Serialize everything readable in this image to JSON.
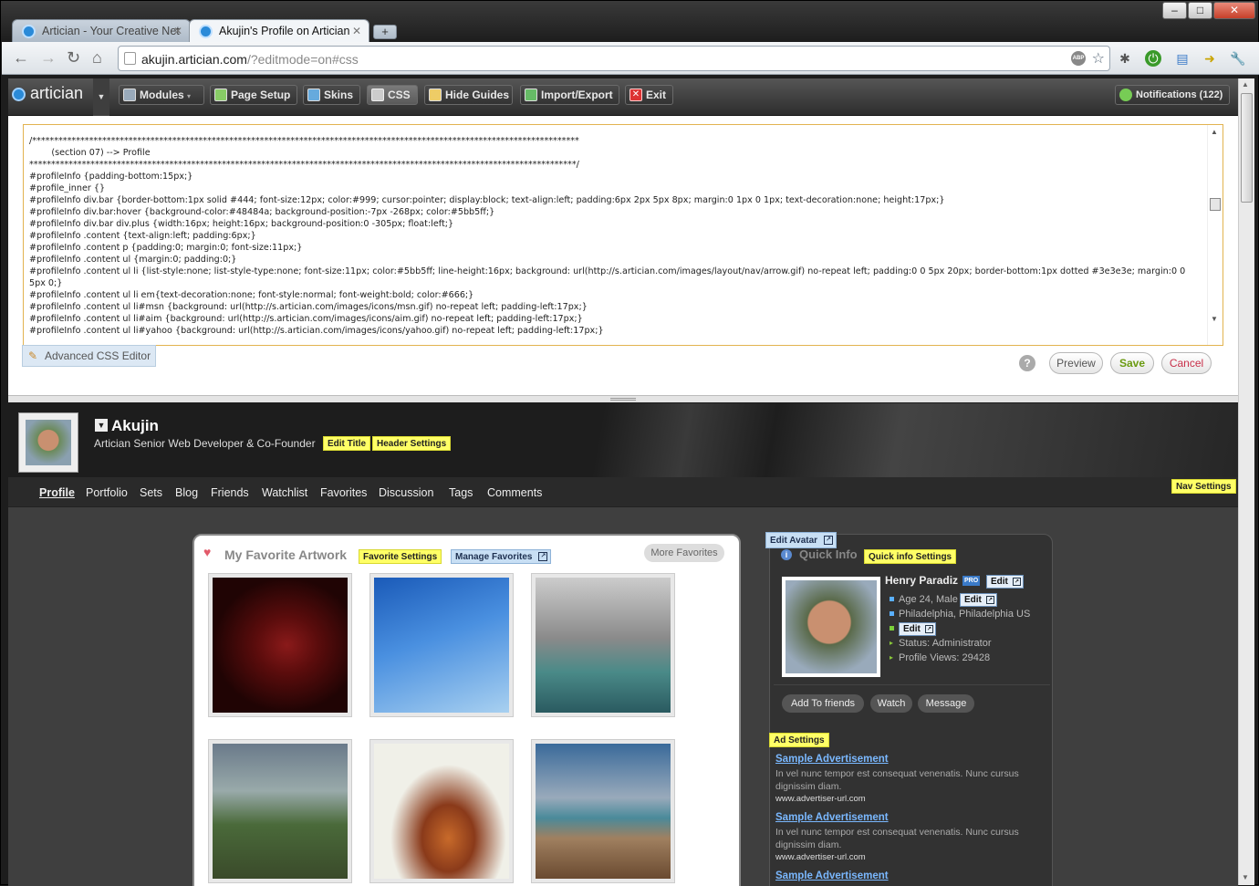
{
  "browser": {
    "tabs": [
      {
        "title": "Artician - Your Creative Net"
      },
      {
        "title": "Akujin's Profile on Artician"
      }
    ],
    "url_host": "akujin.artician.com",
    "url_path": "/?editmode=on#css",
    "window_buttons": {
      "minimize": "–",
      "maximize": "□",
      "close": "✕"
    }
  },
  "editbar": {
    "logo": "artician",
    "buttons": [
      {
        "label": "Modules"
      },
      {
        "label": "Page Setup"
      },
      {
        "label": "Skins"
      },
      {
        "label": "CSS"
      },
      {
        "label": "Hide Guides"
      },
      {
        "label": "Import/Export"
      },
      {
        "label": "Exit"
      }
    ],
    "notifications": "Notifications (122)"
  },
  "css_editor": {
    "code": "/*****************************************************************************************************************************\n        (section 07) --> Profile\n*****************************************************************************************************************************/\n#profileInfo {padding-bottom:15px;}\n#profile_inner {}\n#profileInfo div.bar {border-bottom:1px solid #444; font-size:12px; color:#999; cursor:pointer; display:block; text-align:left; padding:6px 2px 5px 8px; margin:0 1px 0 1px; text-decoration:none; height:17px;}\n#profileInfo div.bar:hover {background-color:#48484a; background-position:-7px -268px; color:#5bb5ff;}\n#profileInfo div.bar div.plus {width:16px; height:16px; background-position:0 -305px; float:left;}\n#profileInfo .content {text-align:left; padding:6px;}\n#profileInfo .content p {padding:0; margin:0; font-size:11px;}\n#profileInfo .content ul {margin:0; padding:0;}\n#profileInfo .content ul li {list-style:none; list-style-type:none; font-size:11px; color:#5bb5ff; line-height:16px; background: url(http://s.artician.com/images/layout/nav/arrow.gif) no-repeat left; padding:0 0 5px 20px; border-bottom:1px dotted #3e3e3e; margin:0 0 5px 0;}\n#profileInfo .content ul li em{text-decoration:none; font-style:normal; font-weight:bold; color:#666;}\n#profileInfo .content ul li#msn {background: url(http://s.artician.com/images/icons/msn.gif) no-repeat left; padding-left:17px;}\n#profileInfo .content ul li#aim {background: url(http://s.artician.com/images/icons/aim.gif) no-repeat left; padding-left:17px;}\n#profileInfo .content ul li#yahoo {background: url(http://s.artician.com/images/icons/yahoo.gif) no-repeat left; padding-left:17px;}",
    "advanced_label": "Advanced CSS Editor",
    "help": "?",
    "preview": "Preview",
    "save": "Save",
    "cancel": "Cancel"
  },
  "profile": {
    "name": "Akujin",
    "subtitle": "Artician Senior Web Developer & Co-Founder",
    "edit_title": "Edit Title",
    "header_settings": "Header Settings",
    "nav": [
      "Profile",
      "Portfolio",
      "Sets",
      "Blog",
      "Friends",
      "Watchlist",
      "Favorites",
      "Discussion",
      "Tags",
      "Comments"
    ],
    "nav_settings": "Nav Settings"
  },
  "favorites": {
    "title": "My Favorite Artwork",
    "favorite_settings": "Favorite Settings",
    "manage_favorites": "Manage Favorites",
    "more": "More Favorites"
  },
  "quickinfo": {
    "edit_avatar": "Edit Avatar",
    "title": "Quick Info",
    "settings": "Quick info Settings",
    "fullname": "Henry Paradiz",
    "pro_badge": "PRO",
    "edit": "Edit",
    "age": "Age 24, Male",
    "location": "Philadelphia, Philadelphia US",
    "status": "Status: Administrator",
    "views": "Profile Views: 29428",
    "buttons": [
      "Add To friends",
      "Watch",
      "Message"
    ],
    "ad_settings": "Ad Settings",
    "ads": [
      {
        "title": "Sample Advertisement",
        "text": "In vel nunc tempor est consequat venenatis. Nunc cursus dignissim diam.",
        "url": "www.advertiser-url.com"
      },
      {
        "title": "Sample Advertisement",
        "text": "In vel nunc tempor est consequat venenatis. Nunc cursus dignissim diam.",
        "url": "www.advertiser-url.com"
      },
      {
        "title": "Sample Advertisement"
      }
    ]
  }
}
